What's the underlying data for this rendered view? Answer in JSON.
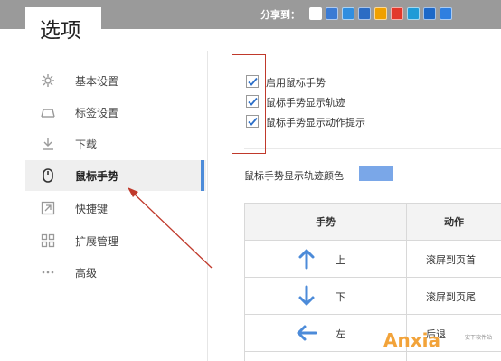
{
  "share_bar": {
    "label": "分享到：",
    "icons": [
      {
        "name": "copy-icon",
        "color": "#ffffff"
      },
      {
        "name": "doc-icon",
        "color": "#3b7bd4"
      },
      {
        "name": "edit-icon",
        "color": "#2f8ee0"
      },
      {
        "name": "renren-icon",
        "color": "#2b6cc4"
      },
      {
        "name": "star-icon",
        "color": "#f0a000"
      },
      {
        "name": "sina-icon",
        "color": "#e2382b"
      },
      {
        "name": "qzone-icon",
        "color": "#1f9bd7"
      },
      {
        "name": "people-icon",
        "color": "#1d68c8"
      },
      {
        "name": "plus-icon",
        "color": "#2f7fe0"
      }
    ]
  },
  "page": {
    "title": "选项"
  },
  "sidebar": {
    "items": [
      {
        "label": "基本设置",
        "icon": "gear-icon",
        "active": false
      },
      {
        "label": "标签设置",
        "icon": "tab-icon",
        "active": false
      },
      {
        "label": "下载",
        "icon": "download-icon",
        "active": false
      },
      {
        "label": "鼠标手势",
        "icon": "mouse-icon",
        "active": true
      },
      {
        "label": "快捷键",
        "icon": "shortcut-icon",
        "active": false
      },
      {
        "label": "扩展管理",
        "icon": "extensions-icon",
        "active": false
      },
      {
        "label": "高级",
        "icon": "more-icon",
        "active": false
      }
    ],
    "accent": "#4c8bd9"
  },
  "settings": {
    "checkboxes": [
      {
        "label": "启用鼠标手势",
        "checked": true
      },
      {
        "label": "鼠标手势显示轨迹",
        "checked": true
      },
      {
        "label": "鼠标手势显示动作提示",
        "checked": true
      }
    ],
    "trail_color_label": "鼠标手势显示轨迹颜色",
    "trail_color": "#7aa7e8"
  },
  "gesture_table": {
    "headers": [
      "手势",
      "动作"
    ],
    "rows": [
      {
        "direction": "上",
        "arrow": "arrow-up-icon",
        "action": "滚屏到页首"
      },
      {
        "direction": "下",
        "arrow": "arrow-down-icon",
        "action": "滚屏到页尾"
      },
      {
        "direction": "左",
        "arrow": "arrow-left-icon",
        "action": "后退"
      }
    ],
    "arrow_color": "#4c8bd9"
  },
  "watermark": {
    "text": "Anxia",
    "sub": "安下软件站"
  },
  "annotation_color": "#c0392b"
}
